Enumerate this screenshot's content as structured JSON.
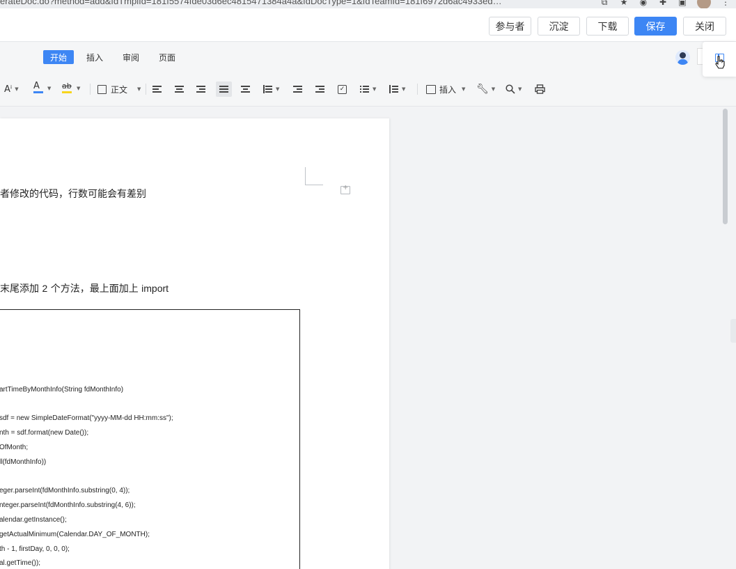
{
  "browser": {
    "address_text": "erateDoc.do?method=add&fdTmplId=181f5574fde03d6ec4815471384a4a&fdDocType=1&fdTeamId=181f6972d6ac4933ed…"
  },
  "top_actions": {
    "participants": "参与者",
    "archive": "沉淀",
    "download": "下载",
    "save": "保存",
    "close": "关闭"
  },
  "menu_tabs": [
    "开始",
    "插入",
    "审阅",
    "页面"
  ],
  "toolbar": {
    "font_size_icon": "Aⁱ",
    "font_color_icon": "A",
    "highlight_icon": "ab",
    "style_label": "正文",
    "insert_label": "插入"
  },
  "document": {
    "para1": "者修改的代码，行数可能会有差别",
    "para2_pre": "末尾添加 ",
    "para2_num": "2",
    "para2_mid": " 个方法，最上面加上 ",
    "para2_kw": "import",
    "code_lines": [
      "artTimeByMonthInfo(String fdMonthInfo)",
      "sdf = new SimpleDateFormat(\"yyyy-MM-dd HH:mm:ss\");",
      "nth = sdf.format(new Date());",
      "OfMonth;",
      "ll(fdMonthInfo))",
      "eger.parseInt(fdMonthInfo.substring(0, 4));",
      "nteger.parseInt(fdMonthInfo.substring(4, 6));",
      "alendar.getInstance();",
      "getActualMinimum(Calendar.DAY_OF_MONTH);",
      "th - 1, firstDay, 0, 0, 0);",
      "al.getTime());"
    ]
  },
  "colors": {
    "accent": "#3d86f4",
    "font_color_bar": "#3d86f4",
    "highlight_bar": "#f7d51d"
  }
}
